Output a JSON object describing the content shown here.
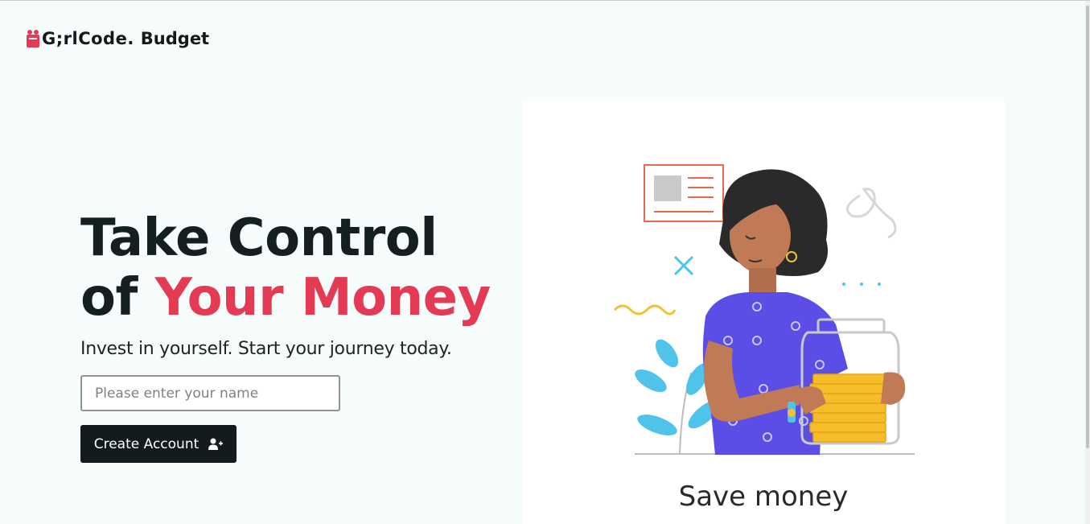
{
  "brand": {
    "girl": "G;rl",
    "code": "Code.",
    "product": "Budget"
  },
  "hero": {
    "headline_line1": "Take Control",
    "headline_of": "of",
    "headline_accent": "Your Money",
    "subtitle": "Invest in yourself. Start your journey today."
  },
  "form": {
    "name_placeholder": "Please enter your name",
    "name_value": "",
    "create_label": "Create Account"
  },
  "feature_card": {
    "caption": "Save money"
  },
  "colors": {
    "accent": "#e43b55",
    "dark": "#121c1c",
    "background": "#f6fbfb"
  },
  "icons": [
    "user-plus-icon",
    "logo-mark-icon"
  ]
}
